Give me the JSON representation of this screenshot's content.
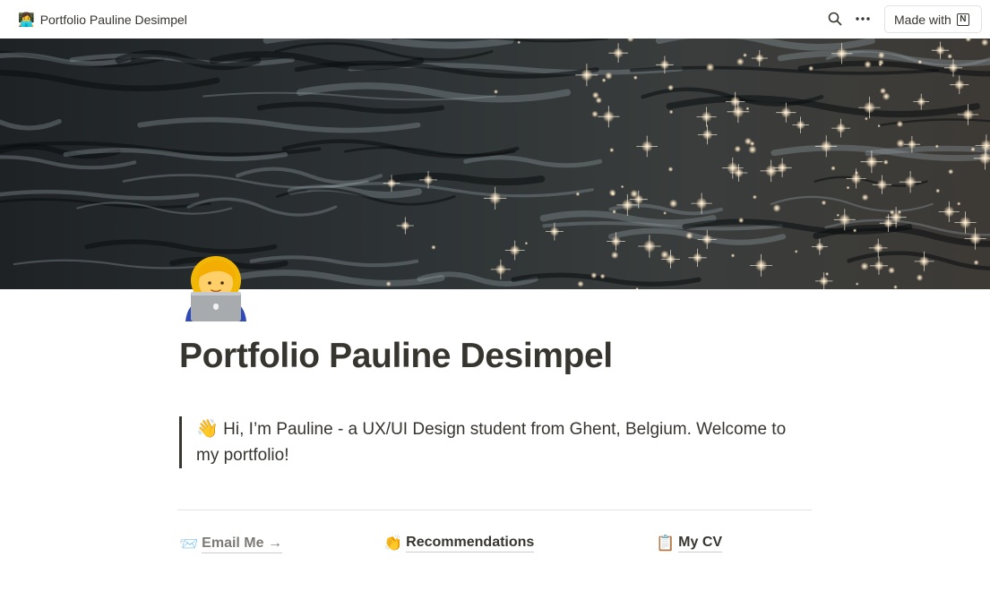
{
  "topbar": {
    "page_emoji": "👩‍💻",
    "page_title": "Portfolio Pauline Desimpel",
    "search_icon": "search-icon",
    "more_icon": "more-horizontal-icon",
    "made_with_label": "Made with",
    "notion_logo_glyph": "N"
  },
  "cover": {
    "description_icon": "water-cover-image"
  },
  "page": {
    "icon": "technologist-woman-emoji",
    "title": "Portfolio Pauline Desimpel",
    "quote": {
      "emoji": "👋",
      "text": " Hi, I’m Pauline - a UX/UI Design student from Ghent, Belgium. Welcome to my portfolio!"
    },
    "links": [
      {
        "emoji": "📨",
        "label": "Email Me →"
      },
      {
        "emoji": "👏",
        "label": "Recommendations"
      },
      {
        "emoji": "📋",
        "label": "My CV"
      }
    ]
  },
  "colors": {
    "text": "#37352f",
    "muted_link": "#7d7b77",
    "border": "#e3e2e0",
    "cover_dark": "#2c3032"
  }
}
